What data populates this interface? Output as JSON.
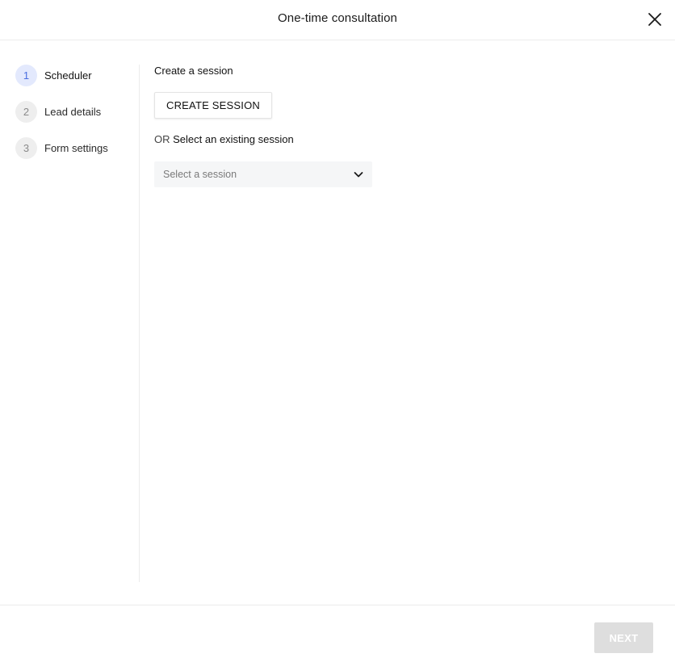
{
  "header": {
    "title": "One-time consultation",
    "close_icon": "close-icon"
  },
  "stepper": {
    "active_index": 0,
    "steps": [
      {
        "number": "1",
        "label": "Scheduler"
      },
      {
        "number": "2",
        "label": "Lead details"
      },
      {
        "number": "3",
        "label": "Form settings"
      }
    ]
  },
  "content": {
    "create_label": "Create a session",
    "create_button": "CREATE SESSION",
    "or_prefix": "OR",
    "select_label": "Select an existing session",
    "session_select": {
      "placeholder": "Select a session",
      "icon": "chevron-down-icon"
    }
  },
  "footer": {
    "next_label": "NEXT"
  },
  "colors": {
    "active_step_bg": "#e3e9fd",
    "active_step_text": "#4a6ee0",
    "disabled_button_bg": "#dedede",
    "select_bg": "#f5f6f7"
  }
}
